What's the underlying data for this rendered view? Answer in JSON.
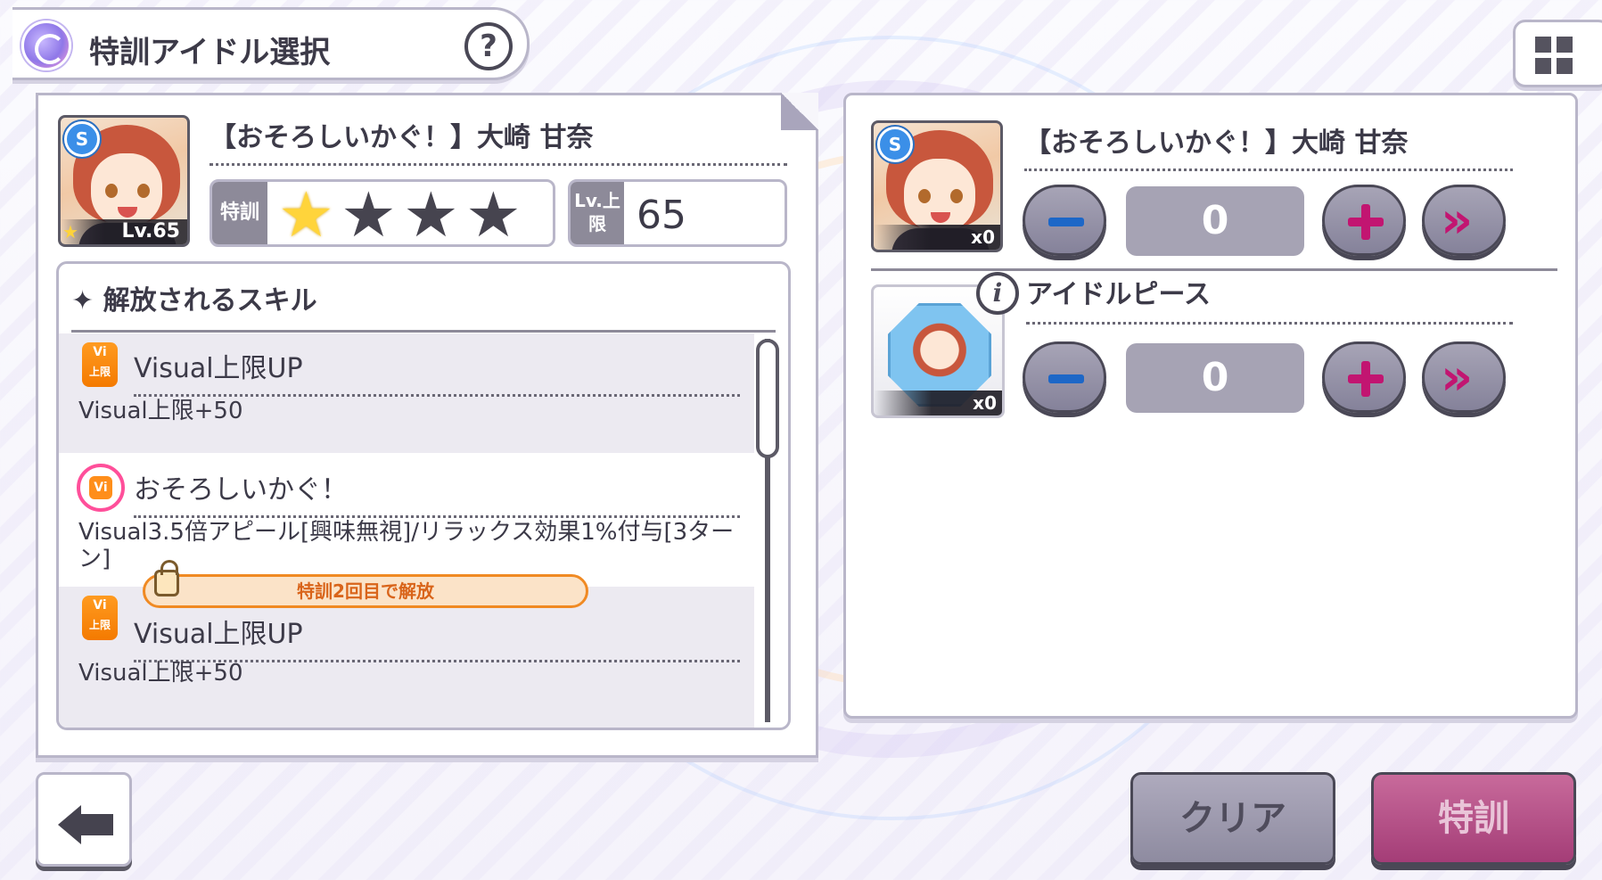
{
  "header": {
    "title": "特訓アイドル選択",
    "help_label": "?"
  },
  "left_card": {
    "card_title": "【おそろしいかぐ！】大崎 甘奈",
    "rarity_badge": "S",
    "level_text": "Lv.65",
    "tokkun_label": "特訓",
    "tokkun_stars_filled": 1,
    "tokkun_stars_total": 4,
    "level_cap_label": "Lv.上限",
    "level_cap_value": "65",
    "skills_header": "✦ 解放されるスキル",
    "skills": [
      {
        "icon": "Vi",
        "icon_sub": "上限",
        "name": "Visual上限UP",
        "desc": "Visual上限+50"
      },
      {
        "icon": "Vi",
        "name": "おそろしいかぐ！",
        "desc": "Visual3.5倍アピール[興味無視]/リラックス効果1%付与[3ターン]"
      },
      {
        "icon": "Vi",
        "icon_sub": "上限",
        "name": "Visual上限UP",
        "desc": "Visual上限+50",
        "lock_text": "特訓2回目で解放"
      }
    ]
  },
  "right_card": {
    "card_title": "【おそろしいかぐ！】大崎 甘奈",
    "card_count": "x0",
    "card_quantity": "0",
    "piece_label": "アイドルピース",
    "piece_count": "x0",
    "piece_quantity": "0"
  },
  "footer": {
    "clear_label": "クリア",
    "tokkun_label": "特訓"
  },
  "colors": {
    "accent_pink": "#c21571",
    "accent_blue": "#1d67c7",
    "vi_orange": "#f47a00",
    "star_gold": "#ffd43b"
  }
}
